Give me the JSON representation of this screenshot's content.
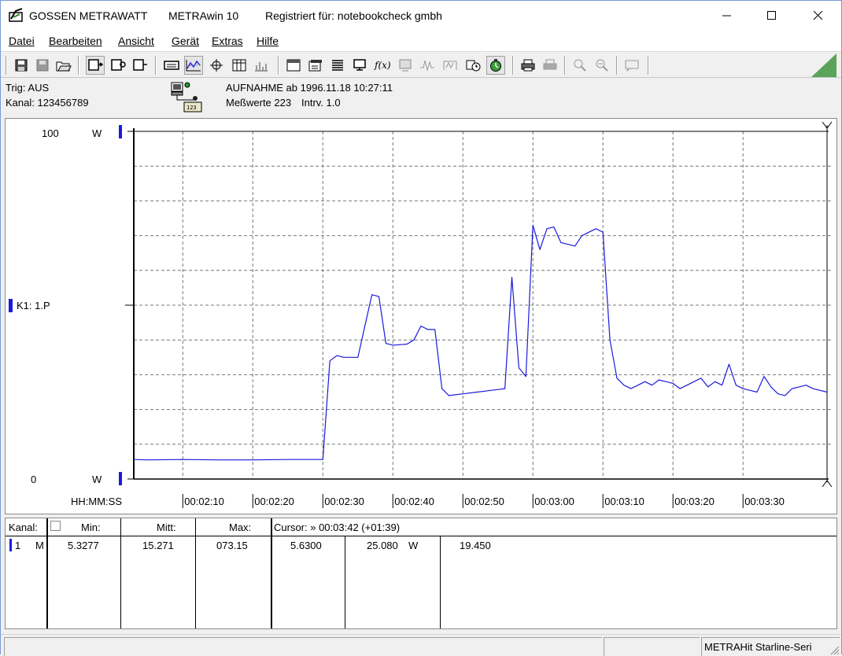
{
  "titlebar": {
    "vendor": "GOSSEN METRAWATT",
    "app": "METRAwin 10",
    "registered": "Registriert für: notebookcheck gmbh"
  },
  "menu": [
    "Datei",
    "Bearbeiten",
    "Ansicht",
    "Gerät",
    "Extras",
    "Hilfe"
  ],
  "toolbar_icons": [
    "save-icon",
    "save-disabled-icon",
    "open-folder-icon",
    "device-connect-icon",
    "device-settings-icon",
    "device-read-icon",
    "keyboard-icon",
    "chart-line-icon",
    "crosshair-icon",
    "table-icon",
    "bar-chart-icon",
    "window-icon",
    "export-icon",
    "list-icon",
    "monitor-icon",
    "formula-icon",
    "display-icon",
    "waveform-icon",
    "signal-icon",
    "clock-settings-icon",
    "stopwatch-icon",
    "print-icon",
    "print-preview-icon",
    "zoom-in-icon",
    "zoom-out-icon",
    "help-icon"
  ],
  "info": {
    "trig": "Trig: AUS",
    "kanal": "Kanal: 123456789",
    "aufnahme": "AUFNAHME ab 1996.11.18 10:27:11",
    "messwerte": "Meßwerte 223",
    "intrv": "Intrv. 1.0"
  },
  "plot": {
    "y_top": "100",
    "y_bottom": "0",
    "y_unit_top": "W",
    "y_unit_bottom": "W",
    "channel_label": "K1: 1.P",
    "x_axis_label": "HH:MM:SS",
    "line_color": "#1a1adc",
    "chart_data": {
      "type": "line",
      "ylabel": "W",
      "xlabel": "HH:MM:SS",
      "ylim": [
        0,
        100
      ],
      "xlim": [
        "00:02:03",
        "00:03:42"
      ],
      "grid": true,
      "tick_labels": [
        "00:02:10",
        "00:02:20",
        "00:02:30",
        "00:02:40",
        "00:02:50",
        "00:03:00",
        "00:03:10",
        "00:03:20",
        "00:03:30"
      ],
      "series": [
        {
          "name": "K1: 1.P",
          "x": [
            "00:02:03",
            "00:02:05",
            "00:02:10",
            "00:02:15",
            "00:02:20",
            "00:02:25",
            "00:02:29",
            "00:02:30",
            "00:02:31",
            "00:02:32",
            "00:02:33",
            "00:02:35",
            "00:02:37",
            "00:02:38",
            "00:02:39",
            "00:02:40",
            "00:02:42",
            "00:02:43",
            "00:02:44",
            "00:02:45",
            "00:02:46",
            "00:02:47",
            "00:02:48",
            "00:02:50",
            "00:02:52",
            "00:02:54",
            "00:02:56",
            "00:02:57",
            "00:02:58",
            "00:02:59",
            "00:03:00",
            "00:03:01",
            "00:03:02",
            "00:03:03",
            "00:03:04",
            "00:03:05",
            "00:03:06",
            "00:03:07",
            "00:03:08",
            "00:03:09",
            "00:03:10",
            "00:03:11",
            "00:03:12",
            "00:03:13",
            "00:03:14",
            "00:03:15",
            "00:03:16",
            "00:03:17",
            "00:03:18",
            "00:03:19",
            "00:03:20",
            "00:03:21",
            "00:03:22",
            "00:03:23",
            "00:03:24",
            "00:03:25",
            "00:03:26",
            "00:03:27",
            "00:03:28",
            "00:03:29",
            "00:03:30",
            "00:03:31",
            "00:03:32",
            "00:03:33",
            "00:03:34",
            "00:03:35",
            "00:03:36",
            "00:03:37",
            "00:03:38",
            "00:03:39",
            "00:03:40",
            "00:03:41",
            "00:03:42"
          ],
          "values": [
            5.6,
            5.5,
            5.6,
            5.5,
            5.5,
            5.6,
            5.6,
            5.6,
            34,
            35.5,
            35,
            35,
            53,
            52.5,
            39,
            38.5,
            38.8,
            40,
            44,
            43,
            43,
            26,
            24,
            24.5,
            25,
            25.5,
            26,
            58,
            32,
            29.5,
            73,
            66,
            72,
            72.5,
            68,
            67.5,
            67,
            70,
            71,
            72,
            71,
            40,
            29,
            27,
            26,
            27,
            28,
            27,
            28.5,
            28,
            27.5,
            26,
            27,
            28,
            29,
            26.5,
            28,
            27,
            33,
            27,
            26,
            25.5,
            25,
            29.5,
            26.5,
            24.5,
            24,
            26,
            26.5,
            27,
            26,
            25.5,
            25
          ]
        }
      ]
    }
  },
  "table": {
    "headers": {
      "kanal": "Kanal:",
      "min": "Min:",
      "mitt": "Mitt:",
      "max": "Max:",
      "cursor": "Cursor: » 00:03:42 (+01:39)"
    },
    "row": {
      "channel": "1",
      "mode": "M",
      "min": "5.3277",
      "mitt": "15.271",
      "max": "073.15",
      "cursor_val": "5.6300",
      "cursor_val2": "25.080",
      "unit": "W",
      "extra": "19.450"
    }
  },
  "statusbar": {
    "device": "METRAHit Starline-Seri"
  }
}
